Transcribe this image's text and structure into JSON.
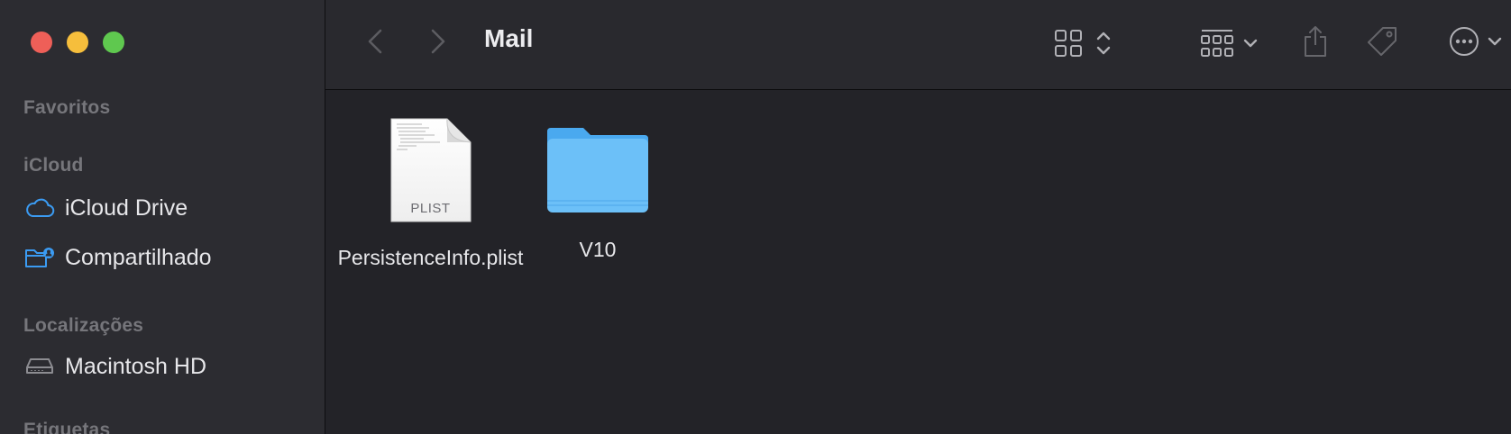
{
  "window": {
    "title": "Mail"
  },
  "sidebar": {
    "sections": [
      {
        "title": "Favoritos",
        "items": []
      },
      {
        "title": "iCloud",
        "items": [
          {
            "label": "iCloud Drive",
            "icon": "cloud-icon"
          },
          {
            "label": "Compartilhado",
            "icon": "shared-folder-icon"
          }
        ]
      },
      {
        "title": "Localizações",
        "items": [
          {
            "label": "Macintosh HD",
            "icon": "hard-drive-icon"
          }
        ]
      },
      {
        "title": "Etiquetas",
        "items": []
      }
    ]
  },
  "files": [
    {
      "name": "PersistenceInfo.plist",
      "type": "plist",
      "badge": "PLIST",
      "icon": "plist-document-icon"
    },
    {
      "name": "V10",
      "type": "folder",
      "icon": "folder-icon"
    }
  ],
  "colors": {
    "accent": "#3b9bf2",
    "folder": "#6cc0f8",
    "close": "#ee5f58",
    "minimize": "#f6be3c",
    "maximize": "#5fc84f"
  }
}
